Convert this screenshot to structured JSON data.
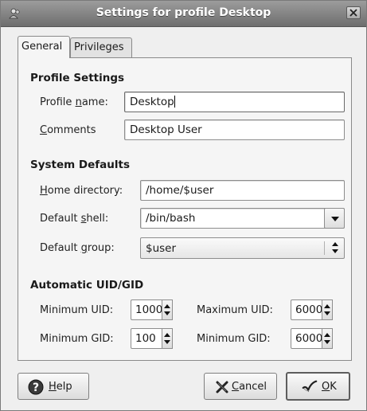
{
  "window": {
    "title": "Settings for profile Desktop"
  },
  "tabs": [
    {
      "label": "General"
    },
    {
      "label": "Privileges"
    }
  ],
  "profile_settings": {
    "heading": "Profile Settings",
    "name_label_pre": "Profile ",
    "name_label_mnemonic": "n",
    "name_label_post": "ame:",
    "name_value": "Desktop",
    "comments_label_mnemonic": "C",
    "comments_label_post": "omments",
    "comments_value": "Desktop User"
  },
  "system_defaults": {
    "heading": "System Defaults",
    "home_label_mnemonic": "H",
    "home_label_post": "ome directory:",
    "home_value": "/home/$user",
    "shell_label_pre": "Default ",
    "shell_label_mnemonic": "s",
    "shell_label_post": "hell:",
    "shell_value": "/bin/bash",
    "group_label_pre": "Default ",
    "group_label_mnemonic": "g",
    "group_label_post": "roup:",
    "group_value": "$user"
  },
  "uid_gid": {
    "heading": "Automatic UID/GID",
    "min_uid_label": "Minimum UID:",
    "min_uid_value": "1000",
    "max_uid_label": "Maximum UID:",
    "max_uid_value": "6000",
    "min_gid_label": "Minimum GID:",
    "min_gid_value": "100",
    "max_gid_label": "Minimum GID:",
    "max_gid_value": "6000"
  },
  "buttons": {
    "help_mnemonic": "H",
    "help_post": "elp",
    "cancel_mnemonic": "C",
    "cancel_post": "ancel",
    "ok_mnemonic": "O",
    "ok_post": "K"
  },
  "icons": {
    "app": "users-icon",
    "close": "close-icon",
    "help": "help-icon",
    "cancel": "cancel-x-icon",
    "ok": "ok-check-icon"
  }
}
